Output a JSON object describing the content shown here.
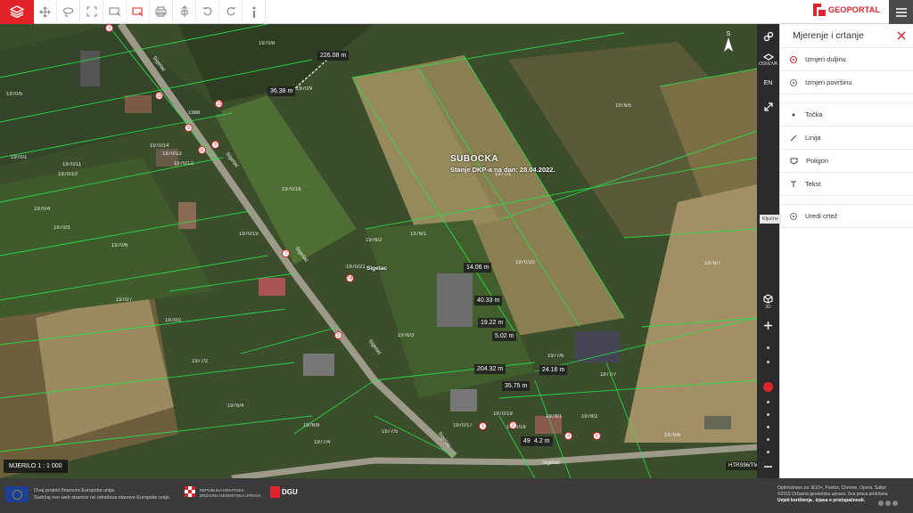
{
  "brand": {
    "name": "GEOPORTAL"
  },
  "toolbar": {
    "tools": [
      "layers-icon",
      "pan-icon",
      "lasso-icon",
      "fullscreen-icon",
      "select-area-icon",
      "measure-icon",
      "print-icon",
      "north-up-icon",
      "undo-icon",
      "redo-icon",
      "info-icon"
    ]
  },
  "map": {
    "title": "SUBOCKA",
    "subtitle": "Stanje DKP-a na dan: 28.04.2022.",
    "place_label": "Sigetac",
    "scale_label": "MJERILO 1 : 1 000",
    "crs_label": "HTRS96/TM",
    "compass_label": "S",
    "measurements": [
      "226.08 m",
      "36.38 m",
      "14.06 m",
      "40.33 m",
      "19.22 m",
      "5.02 m",
      "204.32 m",
      "24.16 m",
      "35.75 m",
      "49",
      "4.2 m"
    ],
    "parcels": [
      "1970/8",
      "1970/5",
      "1970/1",
      "1970/11",
      "1970/10",
      "1970/4",
      "1970/3",
      "1970/6",
      "1970/7",
      "1970/2",
      "1988",
      "1970/14",
      "1970/13",
      "1970/12",
      "1970/9",
      "1970/15",
      "1977/1",
      "1976/5",
      "1976/7",
      "1970/16",
      "1976/2",
      "1976/1",
      "1970/20",
      "1970/21",
      "1976/3",
      "1977/2",
      "1976/4",
      "1976/8",
      "1977/4",
      "1977/5",
      "1977/6",
      "1977/7",
      "1978/1",
      "1978/2",
      "1976/6",
      "1970/19",
      "1970/18",
      "1970/17"
    ],
    "streets": [
      "Sigetac",
      "Sigetac",
      "Sigetac",
      "Sigetac",
      "Sigetac",
      "Sigetac"
    ],
    "house_numbers": [
      "15",
      "13",
      "11",
      "9",
      "7",
      "7A",
      "5",
      "3",
      "1",
      "2",
      "4",
      "6",
      "8"
    ]
  },
  "controls": {
    "osnova_label": "OSNOVA",
    "lang_label": "EN",
    "mode_3d_label": "3D",
    "side_tab_label": "Ključne"
  },
  "panel": {
    "title": "Mjerenje i crtanje",
    "measure_length": "Izmjeri duljinu",
    "measure_area": "Izmjeri površinu",
    "point": "Točka",
    "line": "Linija",
    "polygon": "Poligon",
    "text": "Tekst",
    "edit_drawing": "Uredi crtež"
  },
  "footer": {
    "eu_line1": "Ovaj projekt financira Europska unija.",
    "eu_line2": "Sadržaj ove web stranice ne odražava stavove Europske unije.",
    "hr_line1": "REPUBLIKA HRVATSKA",
    "hr_line2": "DRŽAVNA GEODETSKA UPRAVA",
    "dgu_label": "DGU",
    "optimized": "Optimizirano za: IE10+, Firefox, Chrome, Opera, Safari",
    "copyright": "©2015 Državna geodetska uprava. Sva prava pridržana",
    "links": "Uvjeti korištenja . Izjava o pristupačnosti."
  }
}
